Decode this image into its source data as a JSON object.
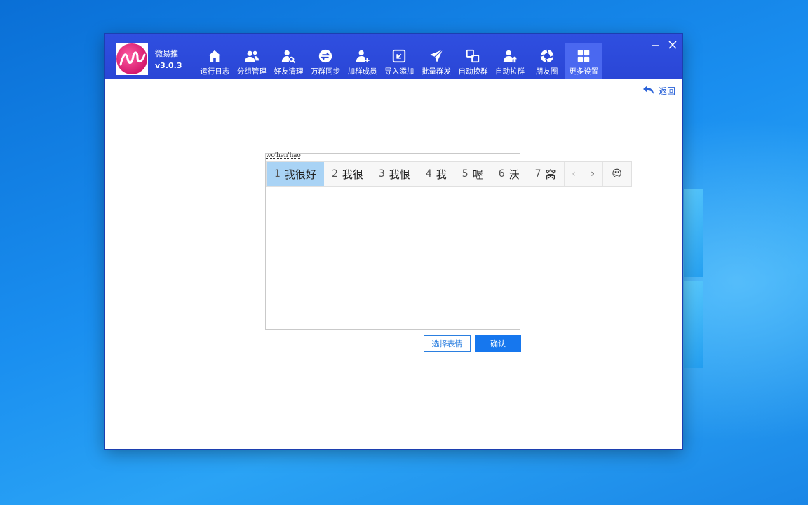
{
  "app": {
    "name": "微易推",
    "version": "v3.0.3"
  },
  "nav": [
    {
      "label": "运行日志",
      "icon": "home-icon"
    },
    {
      "label": "分组管理",
      "icon": "users-icon"
    },
    {
      "label": "好友清理",
      "icon": "user-search-icon"
    },
    {
      "label": "万群同步",
      "icon": "sync-icon"
    },
    {
      "label": "加群成员",
      "icon": "user-add-icon"
    },
    {
      "label": "导入添加",
      "icon": "import-icon"
    },
    {
      "label": "批量群发",
      "icon": "send-icon"
    },
    {
      "label": "自动换群",
      "icon": "switch-icon"
    },
    {
      "label": "自动拉群",
      "icon": "user-up-icon"
    },
    {
      "label": "朋友圈",
      "icon": "aperture-icon"
    },
    {
      "label": "更多设置",
      "icon": "grid-icon"
    }
  ],
  "back_label": "返回",
  "ime": {
    "pinyin": "wo'hen'hao",
    "candidates": [
      {
        "num": "1",
        "text": "我很好"
      },
      {
        "num": "2",
        "text": "我很"
      },
      {
        "num": "3",
        "text": "我恨"
      },
      {
        "num": "4",
        "text": "我"
      },
      {
        "num": "5",
        "text": "喔"
      },
      {
        "num": "6",
        "text": "沃"
      },
      {
        "num": "7",
        "text": "窝"
      }
    ],
    "prev": "‹",
    "next": "›",
    "emoji": "☺"
  },
  "buttons": {
    "choose_emoji": "选择表情",
    "confirm": "确认"
  },
  "colors": {
    "topbar": "#2a46d6",
    "accent": "#1677ee",
    "selected_candidate": "#a9d3f5"
  }
}
